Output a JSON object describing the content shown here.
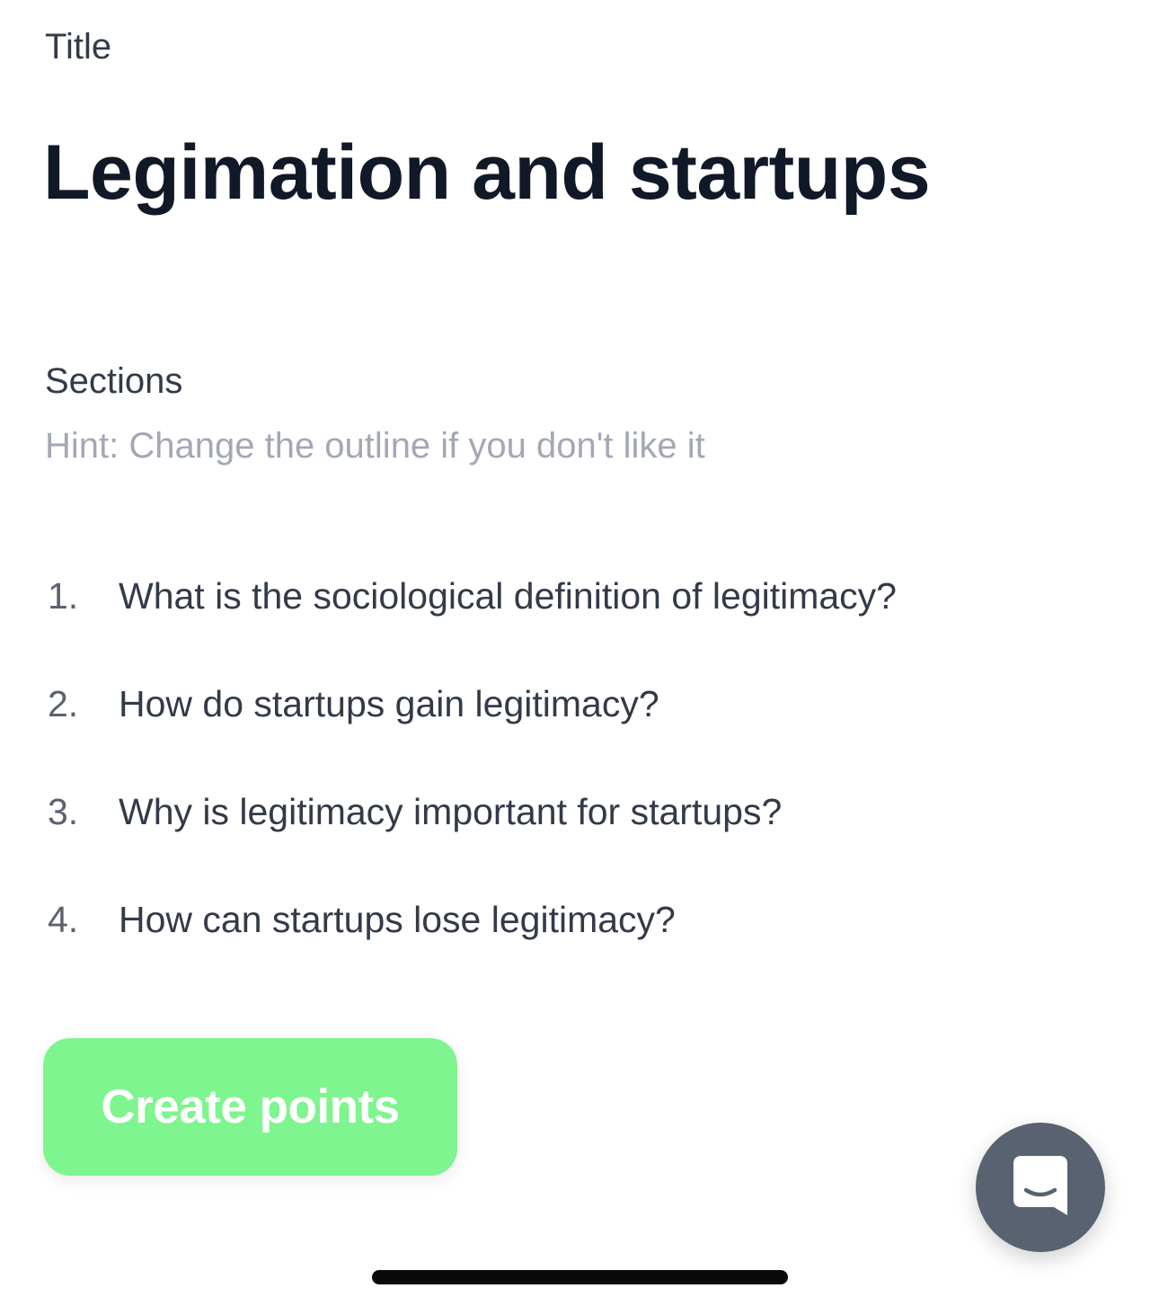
{
  "title": {
    "label": "Title",
    "value": "Legimation and startups"
  },
  "sections": {
    "label": "Sections",
    "hint": "Hint: Change the outline if you don't like it",
    "items": [
      {
        "number": "1.",
        "text": "What is the sociological definition of legitimacy?"
      },
      {
        "number": "2.",
        "text": "How do startups gain legitimacy?"
      },
      {
        "number": "3.",
        "text": "Why is legitimacy important for startups?"
      },
      {
        "number": "4.",
        "text": "How can startups lose legitimacy?"
      }
    ]
  },
  "actions": {
    "create_label": "Create points"
  },
  "chat": {
    "icon": "chat-bubble-smile-icon"
  },
  "colors": {
    "primary_button": "#7ef58e",
    "chat_launcher": "#586271",
    "hint_text": "#a3a8b4",
    "heading_text": "#111827"
  }
}
